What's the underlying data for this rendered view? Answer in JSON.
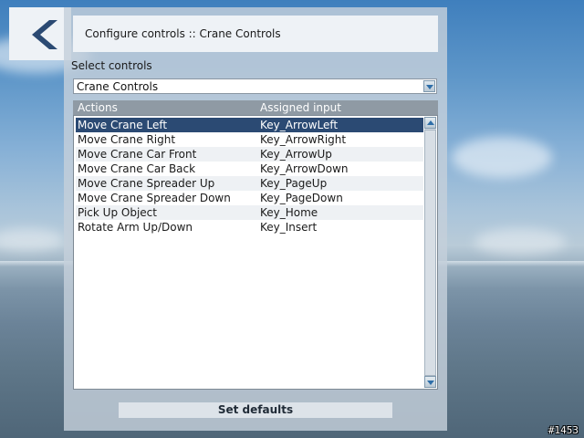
{
  "header": {
    "title": "Configure controls :: Crane Controls"
  },
  "back_button": {
    "icon": "chevron-left-icon",
    "color": "#2b4a73"
  },
  "controls_selector": {
    "label": "Select controls",
    "selected": "Crane Controls"
  },
  "table": {
    "columns": [
      "Actions",
      "Assigned input"
    ],
    "rows": [
      {
        "action": "Move Crane Left",
        "input": "Key_ArrowLeft",
        "selected": true
      },
      {
        "action": "Move Crane Right",
        "input": "Key_ArrowRight"
      },
      {
        "action": "Move Crane Car Front",
        "input": "Key_ArrowUp"
      },
      {
        "action": "Move Crane Car Back",
        "input": "Key_ArrowDown"
      },
      {
        "action": "Move Crane Spreader Up",
        "input": "Key_PageUp"
      },
      {
        "action": "Move Crane Spreader Down",
        "input": "Key_PageDown"
      },
      {
        "action": "Pick Up Object",
        "input": "Key_Home"
      },
      {
        "action": "Rotate Arm Up/Down",
        "input": "Key_Insert"
      }
    ]
  },
  "footer": {
    "defaults_label": "Set defaults"
  },
  "frame_counter": "#1453",
  "colors": {
    "selection": "#2b4a73",
    "header_bg": "#8f9aa4",
    "accent": "#2e6ea8"
  }
}
